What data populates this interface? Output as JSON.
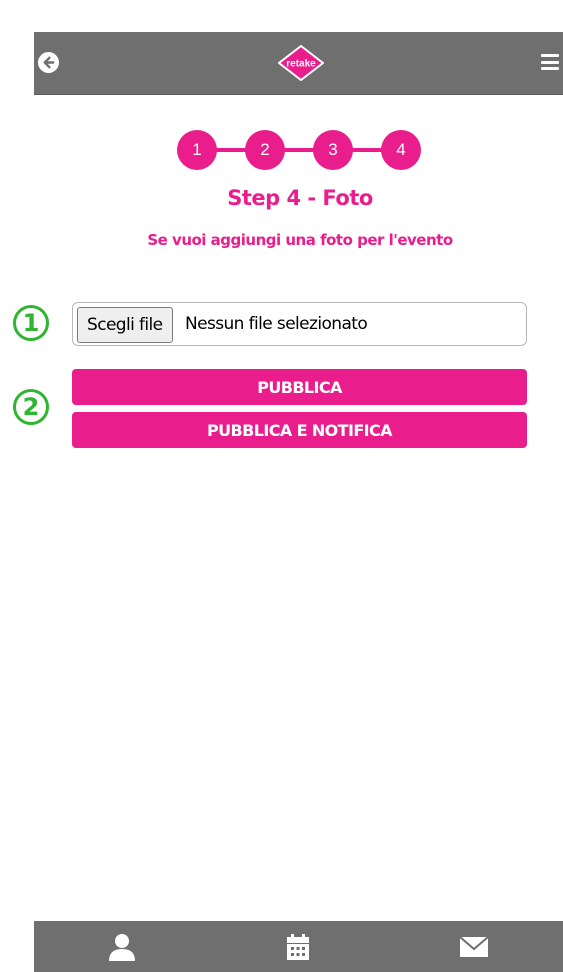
{
  "header": {
    "logo_text": "retake",
    "back_icon": "arrow-left-circle-icon",
    "menu_icon": "hamburger-menu-icon"
  },
  "stepper": {
    "steps": [
      "1",
      "2",
      "3",
      "4"
    ],
    "active_step": "4"
  },
  "content": {
    "title": "Step 4 - Foto",
    "subtitle": "Se vuoi aggiungi una foto per l'evento"
  },
  "annotations": {
    "marker_1": "1",
    "marker_2": "2"
  },
  "file_input": {
    "button_label": "Scegli file",
    "status": "Nessun file selezionato"
  },
  "actions": {
    "publish_label": "PUBBLICA",
    "publish_notify_label": "PUBBLICA E NOTIFICA"
  },
  "bottom_nav": {
    "items": [
      {
        "icon": "user-icon"
      },
      {
        "icon": "calendar-icon"
      },
      {
        "icon": "envelope-icon"
      }
    ]
  },
  "colors": {
    "accent": "#e91e8c",
    "bar": "#6f6f6f",
    "marker": "#2fb52f"
  }
}
